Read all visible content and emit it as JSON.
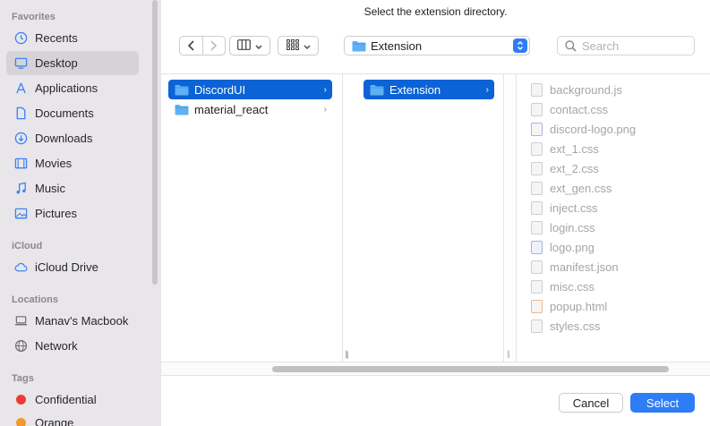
{
  "dialog": {
    "prompt": "Select the extension directory.",
    "cancel_label": "Cancel",
    "select_label": "Select"
  },
  "sidebar": {
    "sections": {
      "favorites": "Favorites",
      "icloud": "iCloud",
      "locations": "Locations",
      "tags": "Tags"
    },
    "favorites": [
      {
        "label": "Recents",
        "icon": "clock-icon"
      },
      {
        "label": "Desktop",
        "icon": "desktop-icon",
        "selected": true
      },
      {
        "label": "Applications",
        "icon": "applications-icon"
      },
      {
        "label": "Documents",
        "icon": "document-icon"
      },
      {
        "label": "Downloads",
        "icon": "download-icon"
      },
      {
        "label": "Movies",
        "icon": "film-icon"
      },
      {
        "label": "Music",
        "icon": "music-note-icon"
      },
      {
        "label": "Pictures",
        "icon": "photo-icon"
      }
    ],
    "icloud": [
      {
        "label": "iCloud Drive",
        "icon": "cloud-icon"
      }
    ],
    "locations": [
      {
        "label": "Manav's Macbook",
        "icon": "laptop-icon"
      },
      {
        "label": "Network",
        "icon": "globe-icon"
      }
    ],
    "tags": [
      {
        "label": "Confidential",
        "color": "#ea3d35"
      },
      {
        "label": "Orange",
        "color": "#f4982f"
      }
    ]
  },
  "toolbar": {
    "path_label": "Extension",
    "search_placeholder": "Search"
  },
  "columns": [
    {
      "items": [
        {
          "label": "DiscordUI",
          "selected": true
        },
        {
          "label": "material_react",
          "selected": false
        }
      ]
    },
    {
      "items": [
        {
          "label": "Extension",
          "selected": true
        }
      ]
    },
    {
      "files": [
        "background.js",
        "contact.css",
        "discord-logo.png",
        "ext_1.css",
        "ext_2.css",
        "ext_gen.css",
        "inject.css",
        "login.css",
        "logo.png",
        "manifest.json",
        "misc.css",
        "popup.html",
        "styles.css"
      ]
    }
  ],
  "colors": {
    "accent": "#2f7df6",
    "selection": "#0b63d6",
    "sidebar_bg": "#e9e6ea"
  }
}
